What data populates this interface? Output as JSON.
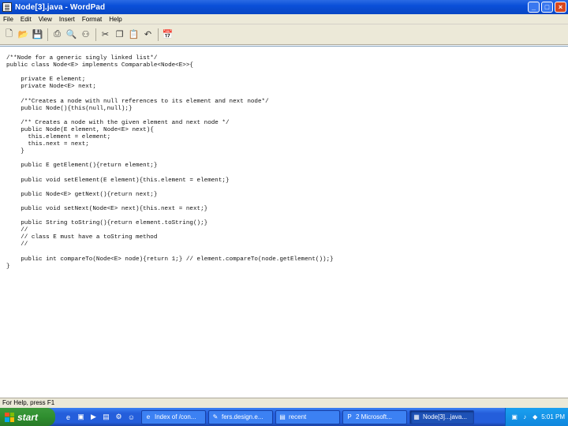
{
  "window": {
    "title": "Node[3].java - WordPad",
    "buttons": {
      "minimize": "_",
      "maximize": "□",
      "close": "×"
    }
  },
  "menu": [
    "File",
    "Edit",
    "View",
    "Insert",
    "Format",
    "Help"
  ],
  "toolbar": {
    "icons": [
      "new-icon",
      "open-icon",
      "save-icon",
      "print-icon",
      "print-preview-icon",
      "find-icon",
      "cut-icon",
      "copy-icon",
      "paste-icon",
      "undo-icon",
      "datetime-icon"
    ]
  },
  "document": {
    "lines": [
      "/**Node for a generic singly linked list*/",
      "public class Node<E> implements Comparable<Node<E>>{",
      "",
      "    private E element;",
      "    private Node<E> next;",
      "",
      "    /**Creates a node with null references to its element and next node*/",
      "    public Node(){this(null,null);}",
      "",
      "    /** Creates a node with the given element and next node */",
      "    public Node(E element, Node<E> next){",
      "      this.element = element;",
      "      this.next = next;",
      "    }",
      "",
      "    public E getElement(){return element;}",
      "",
      "    public void setElement(E element){this.element = element;}",
      "",
      "    public Node<E> getNext(){return next;}",
      "",
      "    public void setNext(Node<E> next){this.next = next;}",
      "",
      "    public String toString(){return element.toString();}",
      "    //",
      "    // class E must have a toString method",
      "    //",
      "",
      "    public int compareTo(Node<E> node){return 1;} // element.compareTo(node.getElement());}",
      "}"
    ]
  },
  "status_bar": {
    "text": "For Help, press F1"
  },
  "taskbar": {
    "start_label": "start",
    "tasks": [
      {
        "label": "Index of /con...",
        "icon": "browser-icon",
        "active": false
      },
      {
        "label": "fers.design.e...",
        "icon": "paint-icon",
        "active": false
      },
      {
        "label": "recent",
        "icon": "folder-icon",
        "active": false
      },
      {
        "label": "2 Microsoft...",
        "icon": "powerpoint-icon",
        "active": false
      },
      {
        "label": "Node[3]...java...",
        "icon": "wordpad-icon",
        "active": true
      }
    ],
    "clock": "5:01 PM"
  }
}
